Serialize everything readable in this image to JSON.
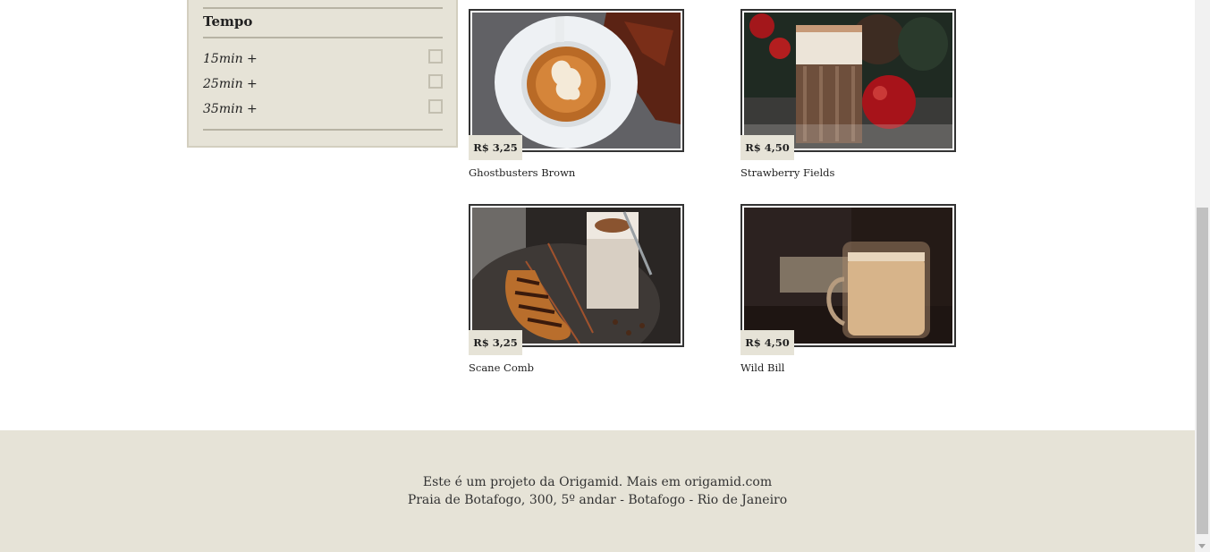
{
  "filter": {
    "title": "Tempo",
    "options": [
      {
        "label": "15min +",
        "checked": false
      },
      {
        "label": "25min +",
        "checked": false
      },
      {
        "label": "35min +",
        "checked": false
      }
    ]
  },
  "products": [
    {
      "name": "Ghostbusters Brown",
      "price": "R$ 3,25",
      "photo": "latte-art-ghost"
    },
    {
      "name": "Strawberry Fields",
      "price": "R$ 4,50",
      "photo": "chocolate-drink-apples"
    },
    {
      "name": "Scane Comb",
      "price": "R$ 3,25",
      "photo": "croissant-iced-coffee"
    },
    {
      "name": "Wild Bill",
      "price": "R$ 4,50",
      "photo": "glass-cup-latte"
    }
  ],
  "footer": {
    "line1": "Este é um projeto da Origamid. Mais em origamid.com",
    "line2": "Praia de Botafogo, 300, 5º andar - Botafogo - Rio de Janeiro"
  },
  "colors": {
    "panel": "#e6e3d7",
    "frame": "#333333",
    "text": "#222222"
  }
}
